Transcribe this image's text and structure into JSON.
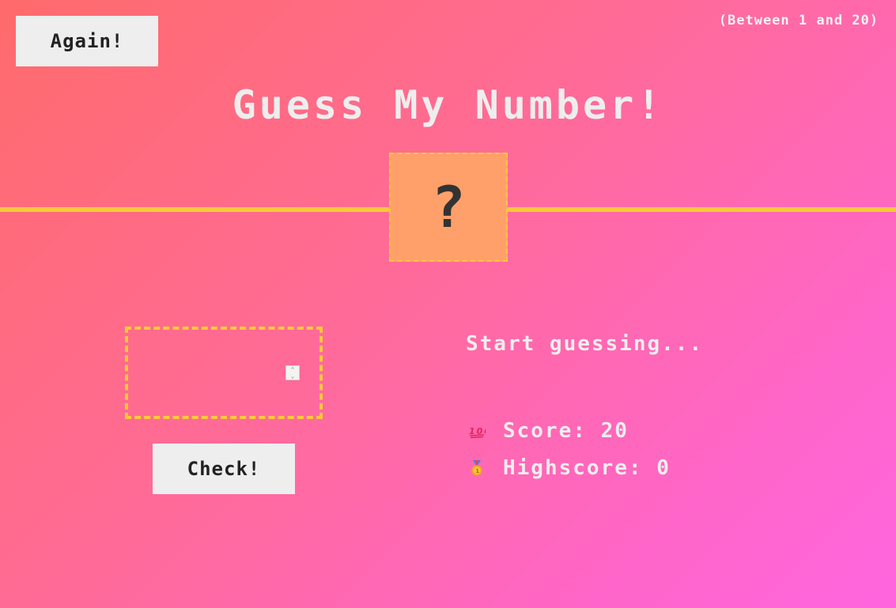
{
  "header": {
    "again_label": "Again!",
    "range_text": "(Between 1 and 20)",
    "title": "Guess My Number!"
  },
  "secret": {
    "display": "?"
  },
  "guess": {
    "value": ""
  },
  "check_label": "Check!",
  "message": "Start guessing...",
  "stats": {
    "score_icon": "hundred-points-icon",
    "score_label": "Score:",
    "score_value": "20",
    "highscore_icon": "medal-icon",
    "highscore_label": "Highscore:",
    "highscore_value": "0"
  },
  "colors": {
    "accent": "#f8c83a",
    "number_box": "#ffa06b",
    "button_bg": "#eeeeee"
  }
}
